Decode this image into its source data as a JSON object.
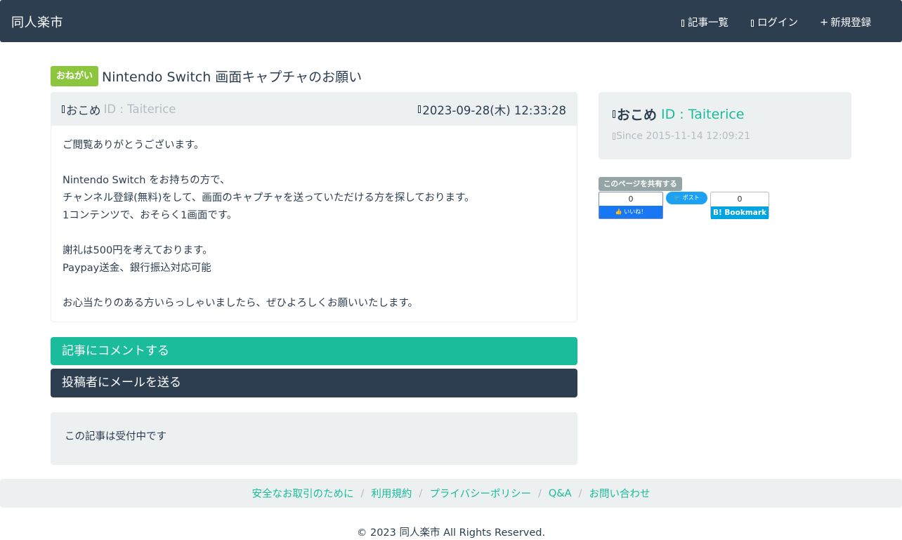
{
  "nav": {
    "brand": "同人楽市",
    "items": [
      {
        "label": "記事一覧",
        "icon": "list-icon"
      },
      {
        "label": "ログイン",
        "icon": "login-icon"
      },
      {
        "label": "新規登録",
        "icon": "plus-icon"
      }
    ],
    "plus_glyph": "+"
  },
  "article": {
    "badge": "おねがい",
    "title": "Nintendo Switch 画面キャプチャのお願い",
    "author": "おこめ",
    "author_id": "ID : Taiterice",
    "date": "2023-09-28(木) 12:33:28",
    "body": [
      "ご閲覧ありがとうございます。",
      "",
      "Nintendo Switch をお持ちの方で、",
      "チャンネル登録(無料)をして、画面のキャプチャを送っていただける方を探しております。",
      "1コンテンツで、おそらく1画面です。",
      "",
      "謝礼は500円を考えております。",
      "Paypay送金、銀行振込対応可能",
      "",
      "お心当たりのある方いらっしゃいましたら、ぜひよろしくお願いいたします。"
    ]
  },
  "actions": {
    "comment": "記事にコメントする",
    "mail": "投稿者にメールを送る"
  },
  "status": "この記事は受付中です",
  "user": {
    "name": "おこめ",
    "id": "ID : Taiterice",
    "since": "Since 2015-11-14 12:09:21"
  },
  "share": {
    "label": "このページを共有する",
    "fb_count": "0",
    "fb_label": "いいね！",
    "tw_label": "ポスト",
    "hb_count": "0",
    "hb_label": "B! Bookmark"
  },
  "footer": {
    "links": [
      "安全なお取引のために",
      "利用規約",
      "プライバシーポリシー",
      "Q&A",
      "お問い合わせ"
    ],
    "separator": "/",
    "copyright": "© 2023 同人楽市 All Rights Reserved."
  },
  "colors": {
    "navbar": "#2c3e50",
    "accent": "#1abc9c",
    "badge": "#8cc63f",
    "well": "#ecf0f1"
  }
}
